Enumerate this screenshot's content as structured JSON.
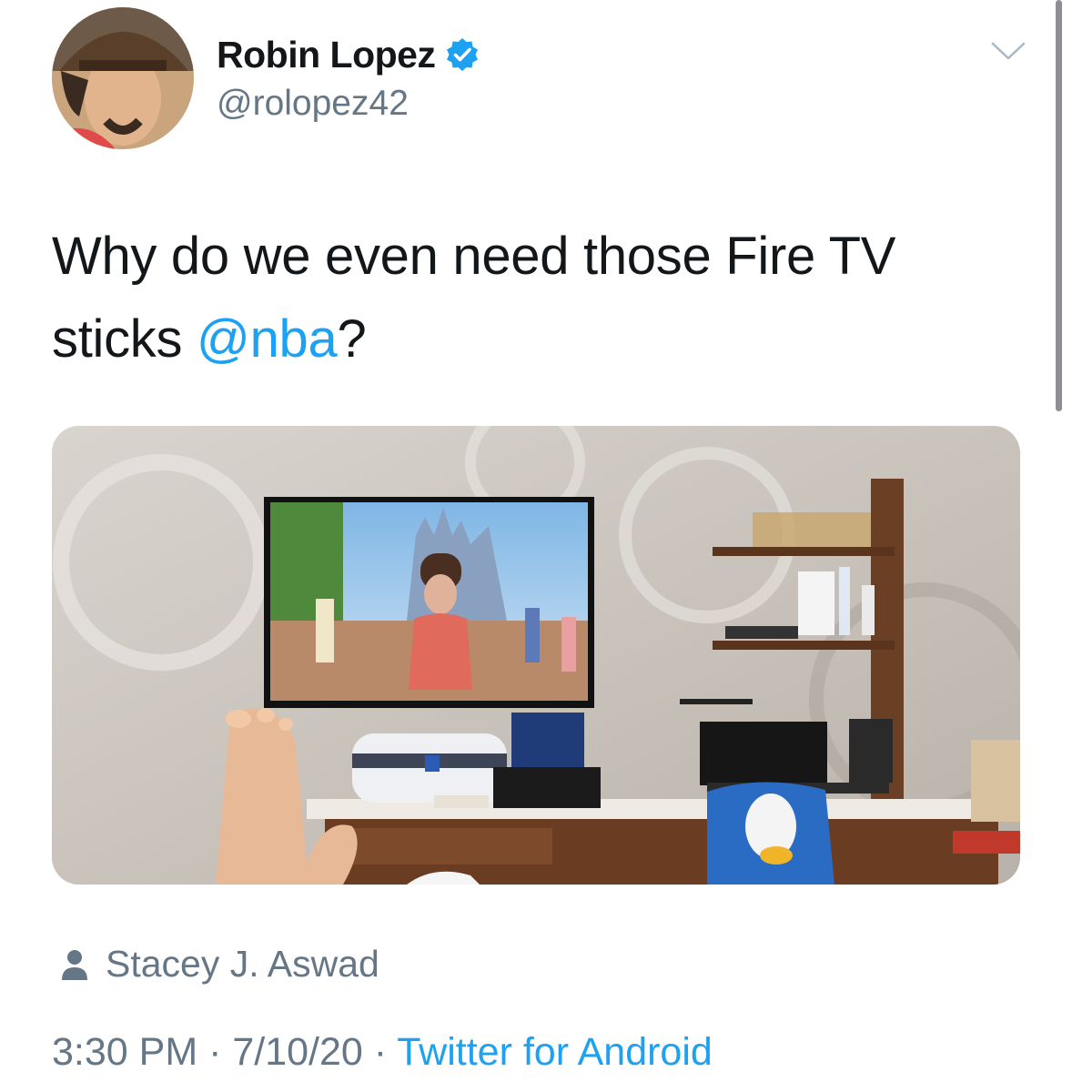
{
  "author": {
    "name": "Robin Lopez",
    "handle": "@rolopez42",
    "verified": true,
    "avatar": "avatar"
  },
  "tweet": {
    "text_before": "Why do we even need those Fire TV sticks ",
    "mention": "@nba",
    "text_after": "?"
  },
  "media": {
    "description_icon": "photo"
  },
  "media_credit": {
    "icon": "person-icon",
    "name": "Stacey J. Aswad"
  },
  "meta": {
    "time": "3:30 PM",
    "separator": " · ",
    "date": "7/10/20",
    "source": "Twitter for Android"
  },
  "colors": {
    "link": "#1da1f2",
    "secondary_text": "#657786",
    "primary_text": "#14171a"
  }
}
